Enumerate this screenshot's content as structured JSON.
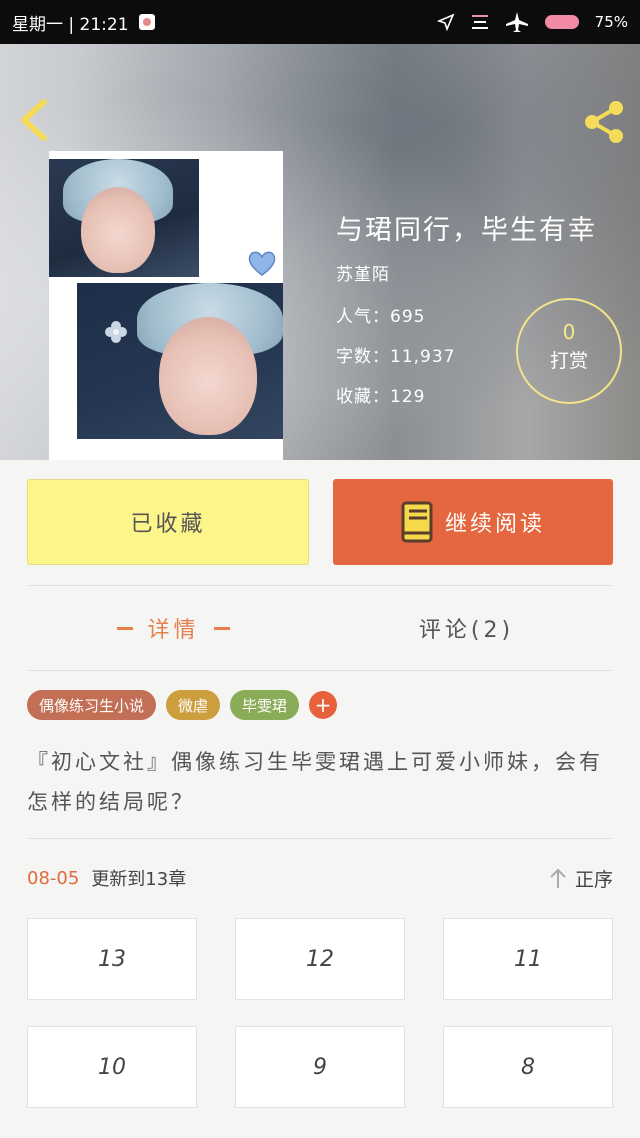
{
  "status_bar": {
    "datetime": "星期一 | 21:21",
    "battery": "75%",
    "icons": [
      "notification-icon",
      "location-arrow-icon",
      "menu-icon",
      "airplane-icon",
      "battery-icon"
    ]
  },
  "header": {
    "back_icon": "chevron-left-icon",
    "share_icon": "share-icon"
  },
  "book": {
    "title": "与珺同行，毕生有幸",
    "author": "苏堇陌",
    "popularity": "人气：695",
    "word_count": "字数：11,937",
    "favorites": "收藏：129"
  },
  "reward": {
    "count": "0",
    "label": "打赏"
  },
  "actions": {
    "favorited_label": "已收藏",
    "continue_label": "继续阅读"
  },
  "tabs": {
    "detail": "详情",
    "comments": "评论(2)"
  },
  "tags": [
    "偶像练习生小说",
    "微虐",
    "毕雯珺"
  ],
  "tag_add": "+",
  "description": "『初心文社』偶像练习生毕雯珺遇上可爱小师妹，会有怎样的结局呢？",
  "chapters": {
    "update_date": "08-05",
    "update_text": "更新到13章",
    "sort_label": "正序",
    "items": [
      "13",
      "12",
      "11",
      "10",
      "9",
      "8"
    ]
  },
  "colors": {
    "accent": "#e4673f",
    "favorite_bg": "#fcf58a",
    "tab_active": "#e67f4c",
    "reward_border": "#f3e389"
  }
}
